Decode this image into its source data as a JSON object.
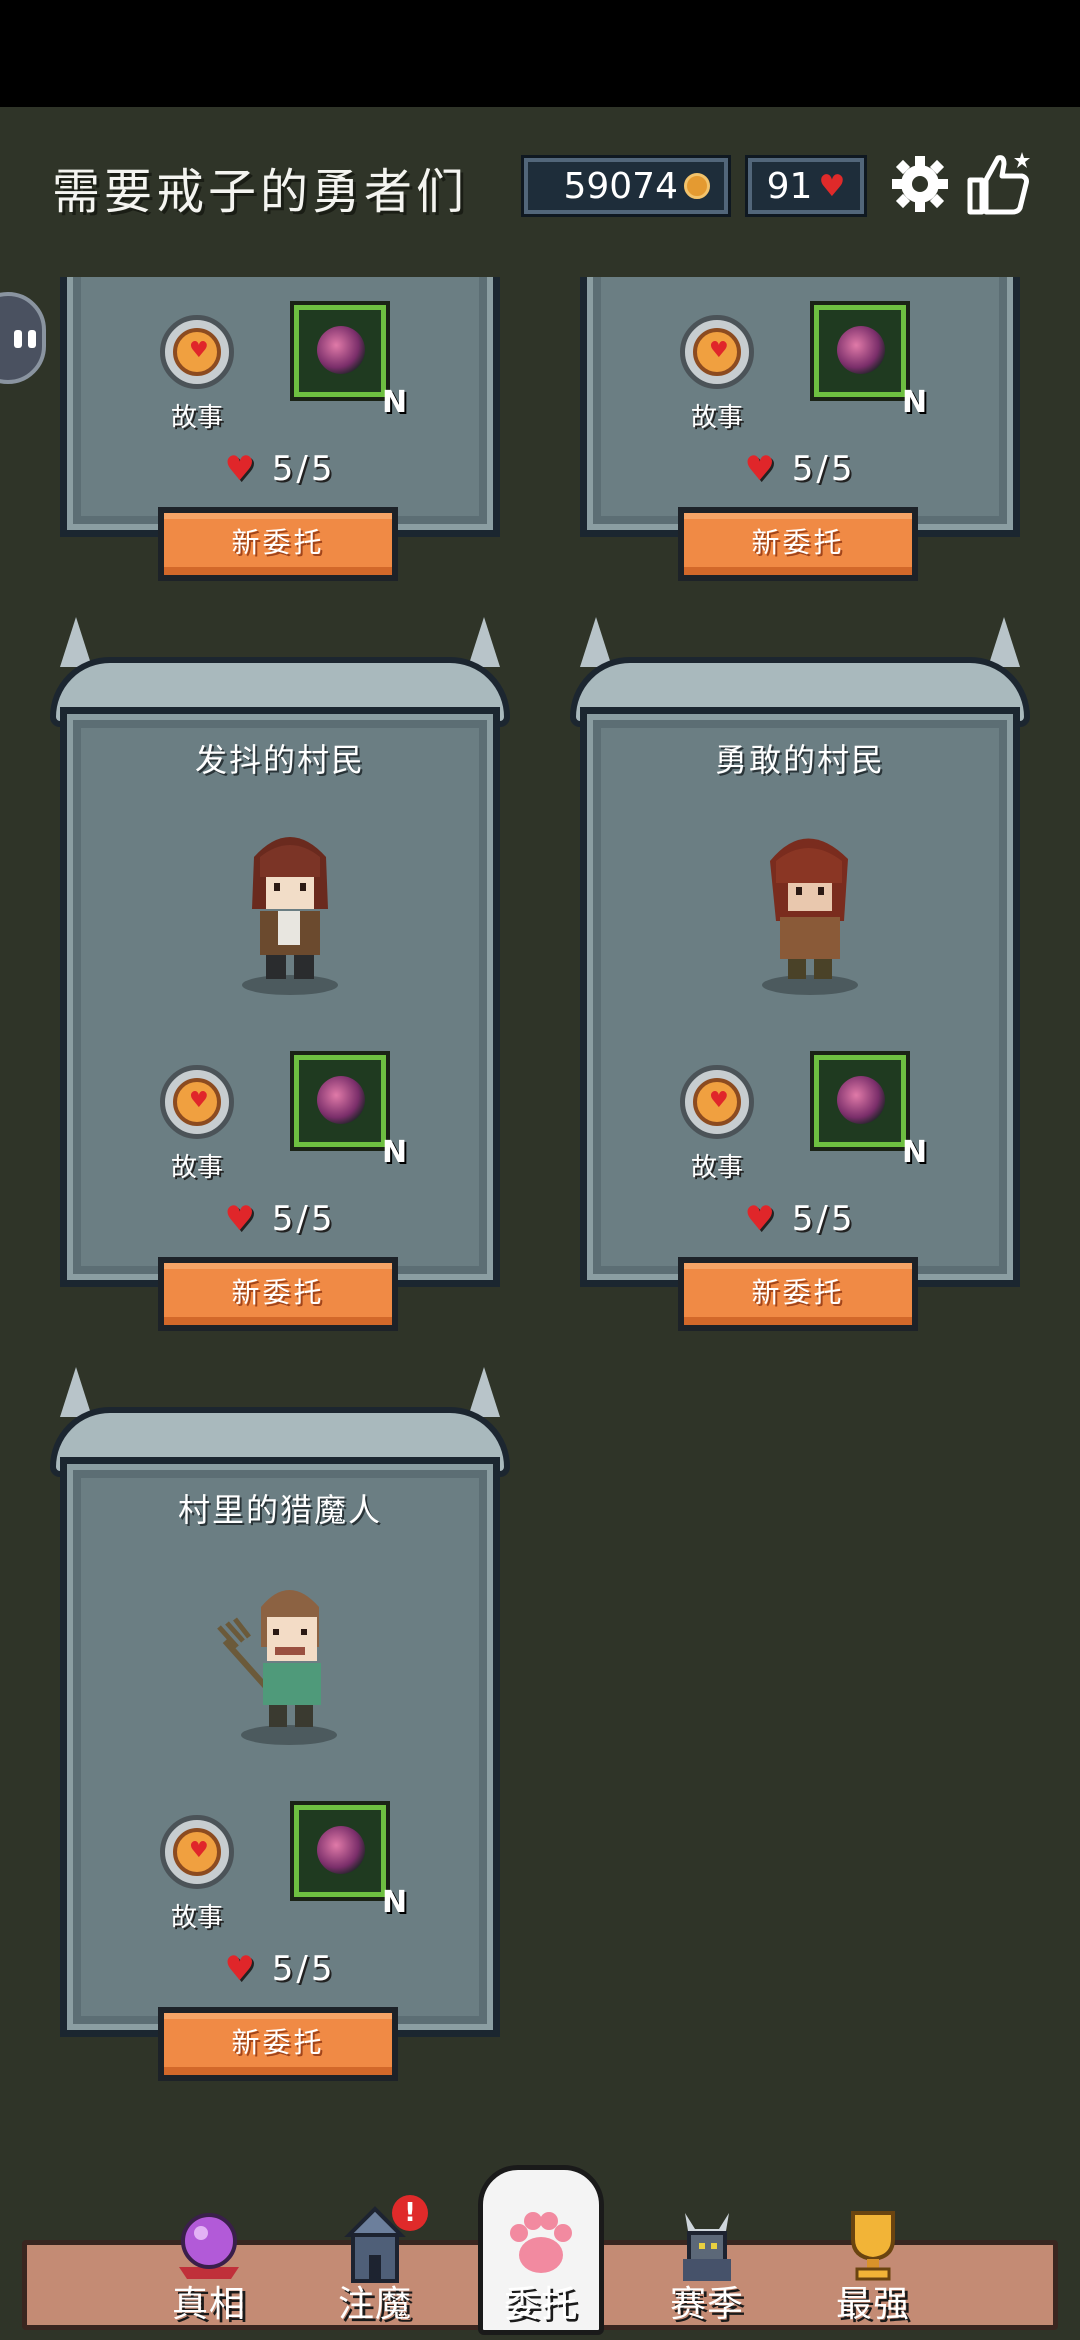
{
  "header": {
    "title": "需要戒子的勇者们",
    "coins": "59074",
    "hearts": "91"
  },
  "cards": [
    {
      "title": "",
      "item_label": "故事",
      "rarity": "N",
      "hp": "5/5",
      "button": "新委托"
    },
    {
      "title": "",
      "item_label": "故事",
      "rarity": "N",
      "hp": "5/5",
      "button": "新委托"
    },
    {
      "title": "发抖的村民",
      "item_label": "故事",
      "rarity": "N",
      "hp": "5/5",
      "button": "新委托"
    },
    {
      "title": "勇敢的村民",
      "item_label": "故事",
      "rarity": "N",
      "hp": "5/5",
      "button": "新委托"
    },
    {
      "title": "村里的猎魔人",
      "item_label": "故事",
      "rarity": "N",
      "hp": "5/5",
      "button": "新委托"
    }
  ],
  "nav": [
    {
      "label": "真相",
      "icon": "crystal-ball-icon"
    },
    {
      "label": "注魔",
      "icon": "tower-icon",
      "alert": "!"
    },
    {
      "label": "委托",
      "icon": "paw-icon",
      "active": true
    },
    {
      "label": "赛季",
      "icon": "knight-icon"
    },
    {
      "label": "最强",
      "icon": "trophy-icon"
    }
  ],
  "colors": {
    "background": "#2f3428",
    "card": "#6b7e83",
    "button": "#f08a45",
    "nav": "#c48b74",
    "rarity_green": "#6ec041"
  }
}
